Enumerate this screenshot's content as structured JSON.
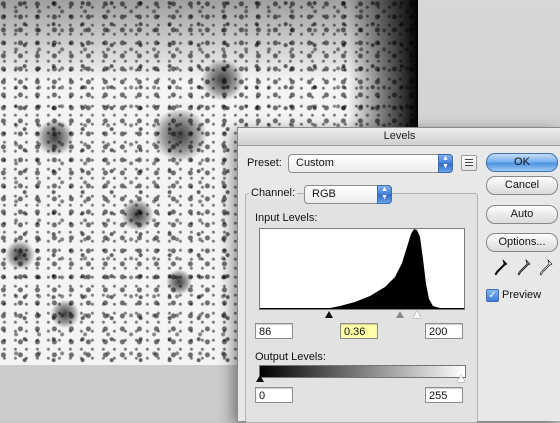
{
  "dialog": {
    "title": "Levels",
    "preset_label": "Preset:",
    "preset_value": "Custom",
    "channel_label": "Channel:",
    "channel_value": "RGB",
    "input_levels_label": "Input Levels:",
    "input_black": "86",
    "input_gamma": "0.36",
    "input_white": "200",
    "output_levels_label": "Output Levels:",
    "output_black": "0",
    "output_white": "255"
  },
  "buttons": {
    "ok": "OK",
    "cancel": "Cancel",
    "auto": "Auto",
    "options": "Options..."
  },
  "preview": {
    "label": "Preview",
    "checked": true
  },
  "icons": {
    "preset_menu": "list-menu-icon",
    "eyedroppers": [
      "black-eyedropper-icon",
      "gray-eyedropper-icon",
      "white-eyedropper-icon"
    ]
  },
  "colors": {
    "default_button": "#4f93e2",
    "gamma_field_highlight": "#ffffa8"
  }
}
